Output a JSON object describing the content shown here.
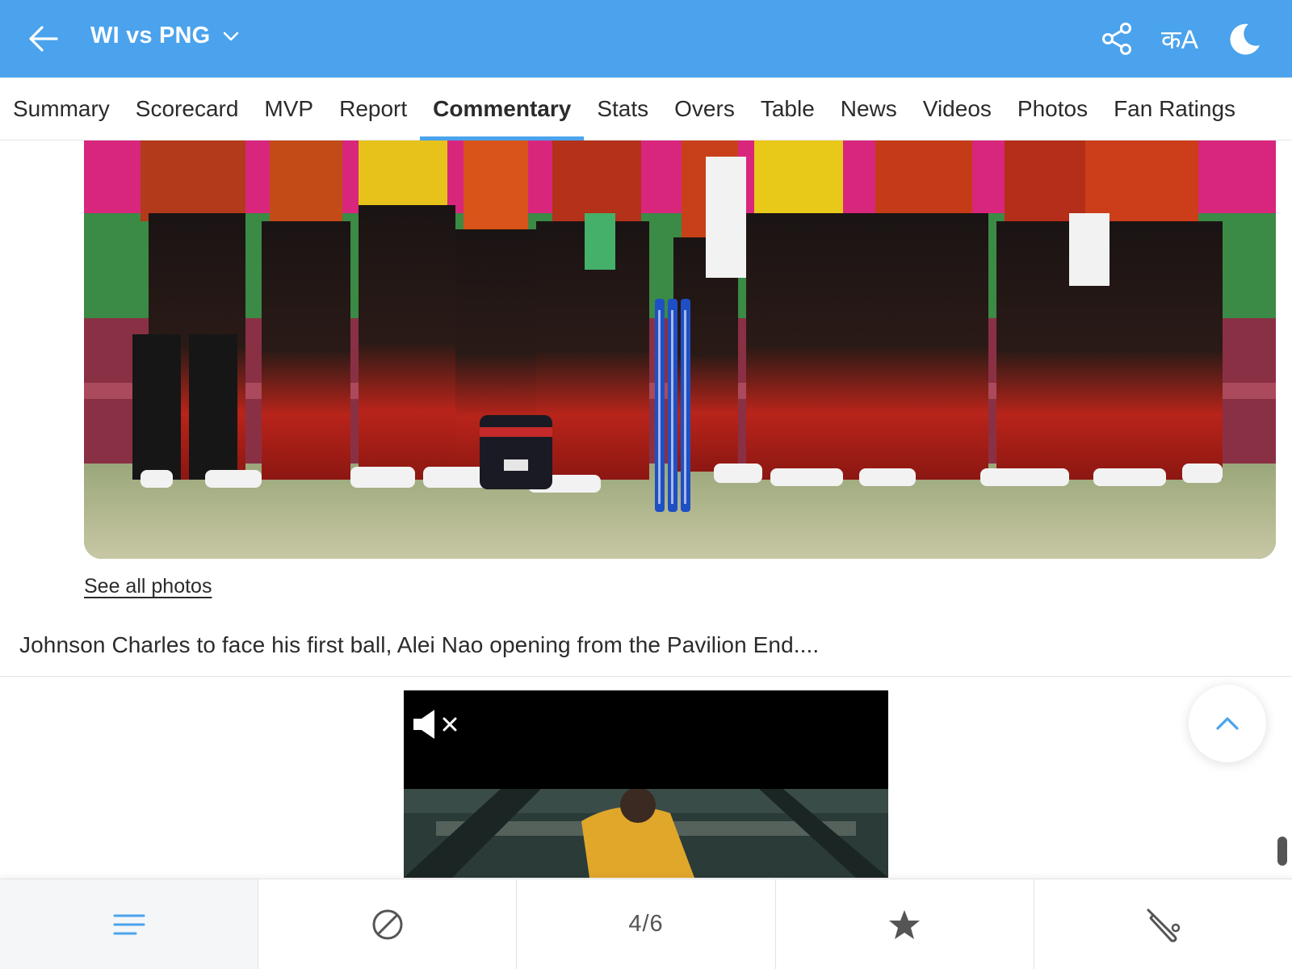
{
  "header": {
    "title": "WI vs PNG",
    "lang_icon_text": "कA",
    "icons": [
      "back-arrow-icon",
      "chevron-down-icon",
      "share-icon",
      "language-icon",
      "moon-icon"
    ],
    "background": "#4aa3ec"
  },
  "tabs": [
    {
      "label": "Summary",
      "active": false
    },
    {
      "label": "Scorecard",
      "active": false
    },
    {
      "label": "MVP",
      "active": false
    },
    {
      "label": "Report",
      "active": false
    },
    {
      "label": "Commentary",
      "active": true
    },
    {
      "label": "Stats",
      "active": false
    },
    {
      "label": "Overs",
      "active": false
    },
    {
      "label": "Table",
      "active": false
    },
    {
      "label": "News",
      "active": false
    },
    {
      "label": "Videos",
      "active": false
    },
    {
      "label": "Photos",
      "active": false
    },
    {
      "label": "Fan Ratings",
      "active": false
    }
  ],
  "main": {
    "see_all_photos": "See all photos",
    "commentary_text": "Johnson Charles to face his first ball, Alei Nao opening from the Pavilion End...."
  },
  "bottom_nav": {
    "page_indicator": "4/6",
    "items": [
      "menu-icon",
      "ball-icon",
      "page-indicator",
      "star-icon",
      "bat-icon"
    ]
  },
  "colors": {
    "accent": "#4aa3ec",
    "text": "#2b2b2b"
  }
}
